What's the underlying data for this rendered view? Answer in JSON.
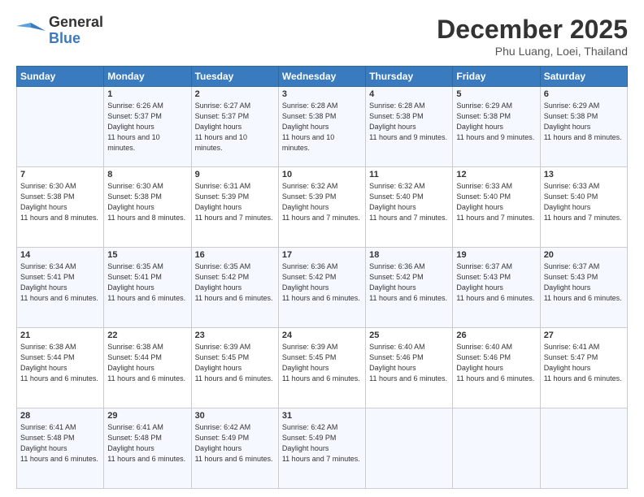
{
  "header": {
    "logo_general": "General",
    "logo_blue": "Blue",
    "month_title": "December 2025",
    "location": "Phu Luang, Loei, Thailand"
  },
  "weekdays": [
    "Sunday",
    "Monday",
    "Tuesday",
    "Wednesday",
    "Thursday",
    "Friday",
    "Saturday"
  ],
  "weeks": [
    [
      {
        "day": "",
        "sunrise": "",
        "sunset": "",
        "daylight": ""
      },
      {
        "day": "1",
        "sunrise": "6:26 AM",
        "sunset": "5:37 PM",
        "daylight": "11 hours and 10 minutes."
      },
      {
        "day": "2",
        "sunrise": "6:27 AM",
        "sunset": "5:37 PM",
        "daylight": "11 hours and 10 minutes."
      },
      {
        "day": "3",
        "sunrise": "6:28 AM",
        "sunset": "5:38 PM",
        "daylight": "11 hours and 10 minutes."
      },
      {
        "day": "4",
        "sunrise": "6:28 AM",
        "sunset": "5:38 PM",
        "daylight": "11 hours and 9 minutes."
      },
      {
        "day": "5",
        "sunrise": "6:29 AM",
        "sunset": "5:38 PM",
        "daylight": "11 hours and 9 minutes."
      },
      {
        "day": "6",
        "sunrise": "6:29 AM",
        "sunset": "5:38 PM",
        "daylight": "11 hours and 8 minutes."
      }
    ],
    [
      {
        "day": "7",
        "sunrise": "6:30 AM",
        "sunset": "5:38 PM",
        "daylight": "11 hours and 8 minutes."
      },
      {
        "day": "8",
        "sunrise": "6:30 AM",
        "sunset": "5:38 PM",
        "daylight": "11 hours and 8 minutes."
      },
      {
        "day": "9",
        "sunrise": "6:31 AM",
        "sunset": "5:39 PM",
        "daylight": "11 hours and 7 minutes."
      },
      {
        "day": "10",
        "sunrise": "6:32 AM",
        "sunset": "5:39 PM",
        "daylight": "11 hours and 7 minutes."
      },
      {
        "day": "11",
        "sunrise": "6:32 AM",
        "sunset": "5:40 PM",
        "daylight": "11 hours and 7 minutes."
      },
      {
        "day": "12",
        "sunrise": "6:33 AM",
        "sunset": "5:40 PM",
        "daylight": "11 hours and 7 minutes."
      },
      {
        "day": "13",
        "sunrise": "6:33 AM",
        "sunset": "5:40 PM",
        "daylight": "11 hours and 7 minutes."
      }
    ],
    [
      {
        "day": "14",
        "sunrise": "6:34 AM",
        "sunset": "5:41 PM",
        "daylight": "11 hours and 6 minutes."
      },
      {
        "day": "15",
        "sunrise": "6:35 AM",
        "sunset": "5:41 PM",
        "daylight": "11 hours and 6 minutes."
      },
      {
        "day": "16",
        "sunrise": "6:35 AM",
        "sunset": "5:42 PM",
        "daylight": "11 hours and 6 minutes."
      },
      {
        "day": "17",
        "sunrise": "6:36 AM",
        "sunset": "5:42 PM",
        "daylight": "11 hours and 6 minutes."
      },
      {
        "day": "18",
        "sunrise": "6:36 AM",
        "sunset": "5:42 PM",
        "daylight": "11 hours and 6 minutes."
      },
      {
        "day": "19",
        "sunrise": "6:37 AM",
        "sunset": "5:43 PM",
        "daylight": "11 hours and 6 minutes."
      },
      {
        "day": "20",
        "sunrise": "6:37 AM",
        "sunset": "5:43 PM",
        "daylight": "11 hours and 6 minutes."
      }
    ],
    [
      {
        "day": "21",
        "sunrise": "6:38 AM",
        "sunset": "5:44 PM",
        "daylight": "11 hours and 6 minutes."
      },
      {
        "day": "22",
        "sunrise": "6:38 AM",
        "sunset": "5:44 PM",
        "daylight": "11 hours and 6 minutes."
      },
      {
        "day": "23",
        "sunrise": "6:39 AM",
        "sunset": "5:45 PM",
        "daylight": "11 hours and 6 minutes."
      },
      {
        "day": "24",
        "sunrise": "6:39 AM",
        "sunset": "5:45 PM",
        "daylight": "11 hours and 6 minutes."
      },
      {
        "day": "25",
        "sunrise": "6:40 AM",
        "sunset": "5:46 PM",
        "daylight": "11 hours and 6 minutes."
      },
      {
        "day": "26",
        "sunrise": "6:40 AM",
        "sunset": "5:46 PM",
        "daylight": "11 hours and 6 minutes."
      },
      {
        "day": "27",
        "sunrise": "6:41 AM",
        "sunset": "5:47 PM",
        "daylight": "11 hours and 6 minutes."
      }
    ],
    [
      {
        "day": "28",
        "sunrise": "6:41 AM",
        "sunset": "5:48 PM",
        "daylight": "11 hours and 6 minutes."
      },
      {
        "day": "29",
        "sunrise": "6:41 AM",
        "sunset": "5:48 PM",
        "daylight": "11 hours and 6 minutes."
      },
      {
        "day": "30",
        "sunrise": "6:42 AM",
        "sunset": "5:49 PM",
        "daylight": "11 hours and 6 minutes."
      },
      {
        "day": "31",
        "sunrise": "6:42 AM",
        "sunset": "5:49 PM",
        "daylight": "11 hours and 7 minutes."
      },
      {
        "day": "",
        "sunrise": "",
        "sunset": "",
        "daylight": ""
      },
      {
        "day": "",
        "sunrise": "",
        "sunset": "",
        "daylight": ""
      },
      {
        "day": "",
        "sunrise": "",
        "sunset": "",
        "daylight": ""
      }
    ]
  ]
}
